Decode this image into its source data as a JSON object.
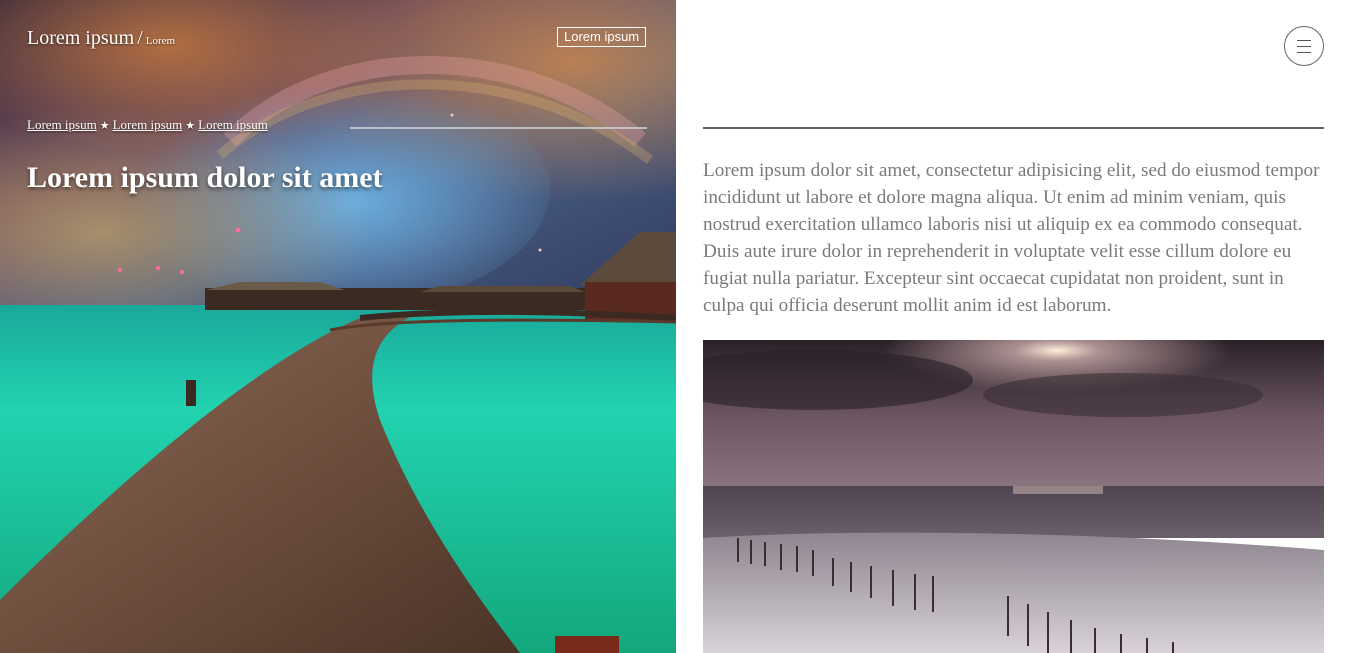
{
  "header": {
    "brand": "Lorem ipsum",
    "brand_separator": "/",
    "brand_sub": "Lorem",
    "button_label": "Lorem ipsum"
  },
  "breadcrumb": {
    "items": [
      "Lorem ipsum",
      "Lorem ipsum",
      "Lorem ipsum"
    ],
    "separator": "★"
  },
  "hero": {
    "title": "Lorem ipsum dolor sit amet",
    "image": "night-sky-boardwalk-over-turquoise-water"
  },
  "article": {
    "body": "Lorem ipsum dolor sit amet, consectetur adipisicing elit, sed do eiusmod tempor incididunt ut labore et dolore magna aliqua. Ut enim ad minim veniam, quis nostrud exercitation ullamco laboris nisi ut aliquip ex ea commodo consequat. Duis aute irure dolor in reprehenderit in voluptate velit esse cillum dolore eu fugiat nulla pariatur. Excepteur sint occaecat cupidatat non proident, sunt in culpa qui officia deserunt mollit anim id est laborum.",
    "image": "moonlit-beach-with-fences"
  },
  "menu": {
    "icon": "hamburger-icon"
  },
  "colors": {
    "body_text": "#7a7a7a",
    "rule": "#5f6468",
    "water": "#1fc9a6",
    "background": "#ffffff"
  }
}
